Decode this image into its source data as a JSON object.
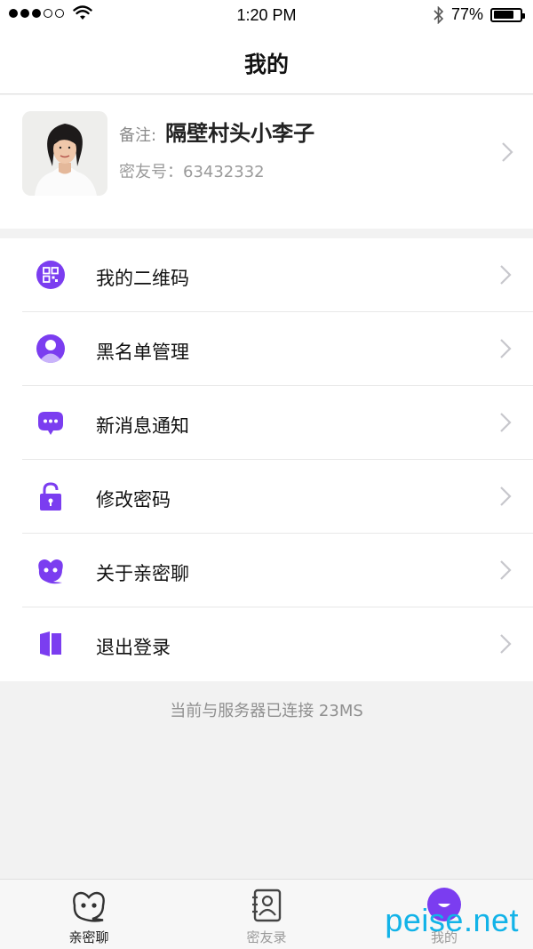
{
  "status_bar": {
    "time": "1:20 PM",
    "battery": "77%",
    "battery_level": 0.77,
    "signal_bars_filled": 3,
    "signal_bars_total": 5
  },
  "header": {
    "title": "我的"
  },
  "profile": {
    "note_label": "备注:",
    "note_name": "隔壁村头小李子",
    "id_text": "密友号：63432332"
  },
  "menu": {
    "items": [
      {
        "label": "我的二维码",
        "icon": "qr-code-icon"
      },
      {
        "label": "黑名单管理",
        "icon": "user-icon"
      },
      {
        "label": "新消息通知",
        "icon": "chat-bubble-icon"
      },
      {
        "label": "修改密码",
        "icon": "lock-icon"
      },
      {
        "label": "关于亲密聊",
        "icon": "app-logo-icon"
      },
      {
        "label": "退出登录",
        "icon": "logout-door-icon"
      }
    ]
  },
  "connection_status": "当前与服务器已连接 23MS",
  "tabs": [
    {
      "label": "亲密聊",
      "icon": "chat-logo-icon",
      "active": false
    },
    {
      "label": "密友录",
      "icon": "contacts-book-icon",
      "active": false
    },
    {
      "label": "我的",
      "icon": "profile-circle-icon",
      "active": true
    }
  ],
  "watermark": "peise.net",
  "colors": {
    "accent_purple": "#7b3df0",
    "accent_purple_light": "#a070f5",
    "watermark_blue": "#12b3e8"
  }
}
